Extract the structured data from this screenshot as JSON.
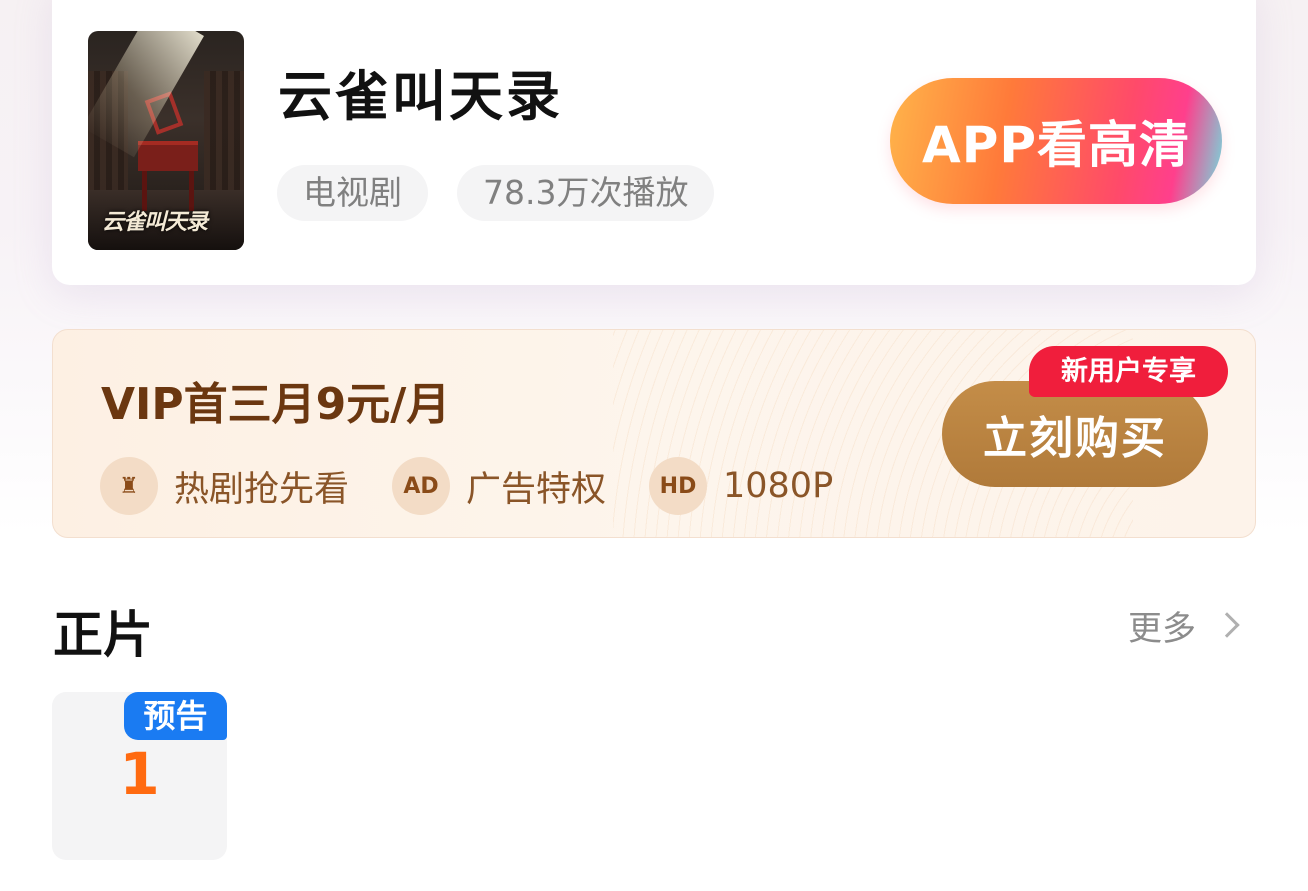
{
  "show": {
    "title": "云雀叫天录",
    "poster_text": "云雀叫天录",
    "tags": {
      "type": "电视剧",
      "plays": "78.3万次播放"
    },
    "app_button": "APP看高清"
  },
  "vip": {
    "title": "VIP首三月9元/月",
    "badge": "新用户专享",
    "buy_button": "立刻购买",
    "perks": [
      {
        "label": "热剧抢先看",
        "icon": "sofa-icon",
        "glyph": "♜"
      },
      {
        "label": "广告特权",
        "icon": "ad-icon",
        "glyph": "AD"
      },
      {
        "label": "1080P",
        "icon": "hd-icon",
        "glyph": "HD"
      }
    ]
  },
  "episodes": {
    "section_title": "正片",
    "more_label": "更多",
    "items": [
      {
        "number": "1",
        "badge": "预告"
      }
    ]
  },
  "colors": {
    "app_gradient": [
      "#ffb44a",
      "#ff4a6a",
      "#6ee0e0"
    ],
    "vip_text": "#6b3710",
    "buy_button": "#b07a3a",
    "new_badge": "#f01e3c",
    "episode_badge": "#1a7bf2",
    "episode_number": "#ff6a10"
  }
}
